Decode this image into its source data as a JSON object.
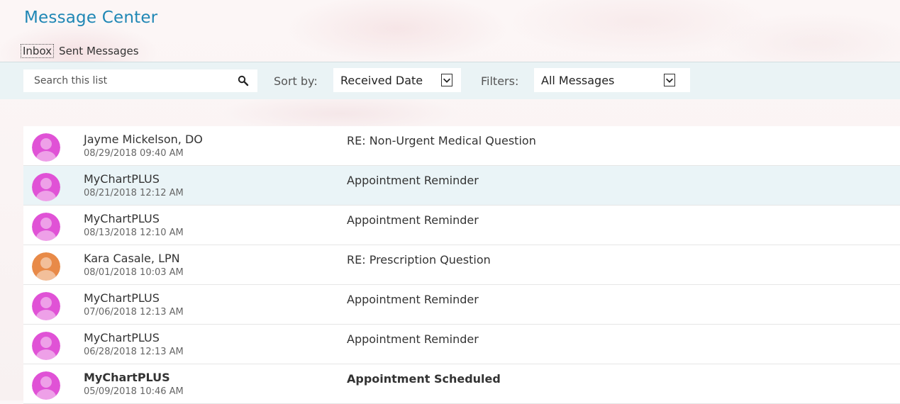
{
  "header": {
    "title": "Message Center"
  },
  "tabs": [
    {
      "label": "Inbox",
      "active": true
    },
    {
      "label": "Sent Messages",
      "active": false
    }
  ],
  "toolbar": {
    "search_placeholder": "Search this list",
    "sort_label": "Sort by:",
    "sort_value": "Received Date",
    "filter_label": "Filters:",
    "filter_value": "All Messages"
  },
  "messages": [
    {
      "sender": "Jayme Mickelson, DO",
      "date": "08/29/2018 09:40 AM",
      "subject": "RE: Non-Urgent Medical Question",
      "avatar_color": "#e052d6",
      "highlighted": false,
      "unread": false
    },
    {
      "sender": "MyChartPLUS",
      "date": "08/21/2018 12:12 AM",
      "subject": "Appointment Reminder",
      "avatar_color": "#e052d6",
      "highlighted": true,
      "unread": false
    },
    {
      "sender": "MyChartPLUS",
      "date": "08/13/2018 12:10 AM",
      "subject": "Appointment Reminder",
      "avatar_color": "#e052d6",
      "highlighted": false,
      "unread": false
    },
    {
      "sender": "Kara Casale, LPN",
      "date": "08/01/2018 10:03 AM",
      "subject": "RE: Prescription Question",
      "avatar_color": "#e88a48",
      "highlighted": false,
      "unread": false
    },
    {
      "sender": "MyChartPLUS",
      "date": "07/06/2018 12:13 AM",
      "subject": "Appointment Reminder",
      "avatar_color": "#e052d6",
      "highlighted": false,
      "unread": false
    },
    {
      "sender": "MyChartPLUS",
      "date": "06/28/2018 12:13 AM",
      "subject": "Appointment Reminder",
      "avatar_color": "#e052d6",
      "highlighted": false,
      "unread": false
    },
    {
      "sender": "MyChartPLUS",
      "date": "05/09/2018 10:46 AM",
      "subject": "Appointment Scheduled",
      "avatar_color": "#e052d6",
      "highlighted": false,
      "unread": true
    }
  ],
  "colors": {
    "accent": "#1f87b5",
    "toolbar_bg": "#eaf3f5",
    "row_highlight": "#eaf4f7"
  },
  "icons": {
    "search": "search-icon",
    "dropdown": "chevron-down-icon",
    "avatar": "person-avatar-icon"
  }
}
